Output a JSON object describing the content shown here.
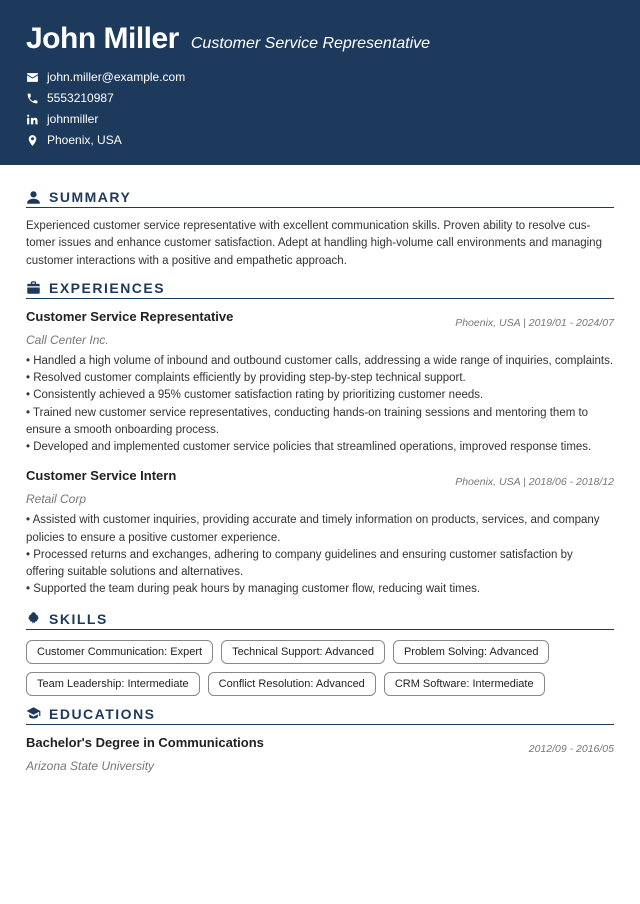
{
  "header": {
    "name": "John Miller",
    "title": "Customer Service Representative",
    "email": "john.miller@example.com",
    "phone": "5553210987",
    "linkedin": "johnmiller",
    "location": "Phoenix, USA"
  },
  "sections": {
    "summary_title": "SUMMARY",
    "experiences_title": "EXPERIENCES",
    "skills_title": "SKILLS",
    "educations_title": "EDUCATIONS"
  },
  "summary": "Experienced customer service representative with excellent communication skills. Proven ability to resolve cus­tomer issues and enhance customer satisfaction. Adept at handling high-volume call environments and manag­ing customer interactions with a positive and empathetic approach.",
  "experiences": [
    {
      "role": "Customer Service Representative",
      "company": "Call Center Inc.",
      "meta": "Phoenix, USA  |  2019/01 - 2024/07",
      "bullets": [
        "• Handled a high volume of inbound and outbound customer calls, addressing a wide range of inquiries, complain­ts.",
        "• Resolved customer complaints efficiently by providing step-by-step technical support.",
        "• Consistently achieved a 95% customer satisfaction rating by prioritizing customer needs.",
        "• Trained new customer service representatives, conducting hands-on training sessions and mentoring them to ensure a smooth onboarding process.",
        "• Developed and implemented customer service policies that streamlined operations, improved response times."
      ]
    },
    {
      "role": "Customer Service Intern",
      "company": "Retail Corp",
      "meta": "Phoenix, USA  |  2018/06 - 2018/12",
      "bullets": [
        "• Assisted with customer inquiries, providing accurate and timely information on products, services, and company policies to ensure a positive customer experience.",
        "• Processed returns and exchanges, adhering to company guidelines and ensuring customer satisfaction by offering suitable solutions and alternatives.",
        "• Supported the team during peak hours by managing customer flow, reducing wait times."
      ]
    }
  ],
  "skills": [
    "Customer Communication: Expert",
    "Technical Support: Advanced",
    "Problem Solving: Advanced",
    "Team Leadership: Intermediate",
    "Conflict Resolution: Advanced",
    "CRM Software: Intermediate"
  ],
  "education": {
    "degree": "Bachelor's Degree in Communications",
    "school": "Arizona State University",
    "meta": "2012/09 - 2016/05"
  }
}
